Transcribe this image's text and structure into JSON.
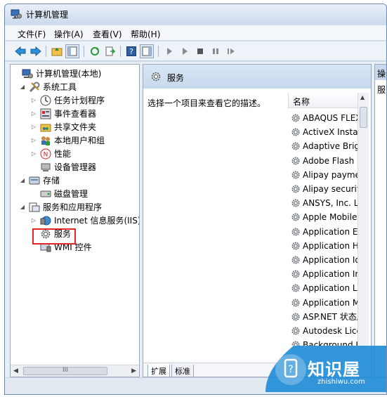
{
  "window": {
    "title": "计算机管理"
  },
  "menu": [
    "文件(F)",
    "操作(A)",
    "查看(V)",
    "帮助(H)"
  ],
  "tree": {
    "items": [
      {
        "label": "计算机管理(本地)",
        "expanded": true,
        "level": 0,
        "icon": "computer-mgmt-icon"
      },
      {
        "label": "系统工具",
        "expanded": true,
        "level": 1,
        "icon": "tools-icon"
      },
      {
        "label": "任务计划程序",
        "expanded": false,
        "level": 2,
        "icon": "clock-icon"
      },
      {
        "label": "事件查看器",
        "expanded": false,
        "level": 2,
        "icon": "event-viewer-icon"
      },
      {
        "label": "共享文件夹",
        "expanded": false,
        "level": 2,
        "icon": "shared-folder-icon"
      },
      {
        "label": "本地用户和组",
        "expanded": false,
        "level": 2,
        "icon": "users-icon"
      },
      {
        "label": "性能",
        "expanded": false,
        "level": 2,
        "icon": "performance-icon"
      },
      {
        "label": "设备管理器",
        "level": 2,
        "icon": "device-manager-icon"
      },
      {
        "label": "存储",
        "expanded": true,
        "level": 1,
        "icon": "storage-icon"
      },
      {
        "label": "磁盘管理",
        "level": 2,
        "icon": "disk-icon"
      },
      {
        "label": "服务和应用程序",
        "expanded": true,
        "level": 1,
        "icon": "services-apps-icon"
      },
      {
        "label": "Internet 信息服务(IIS)管",
        "expanded": false,
        "level": 2,
        "icon": "iis-icon"
      },
      {
        "label": "服务",
        "level": 2,
        "icon": "gear-icon",
        "highlighted": true
      },
      {
        "label": "WMI 控件",
        "level": 2,
        "icon": "wmi-icon"
      }
    ],
    "hscroll_thumb": "III"
  },
  "middle": {
    "header": "服务",
    "description": "选择一个项目来查看它的描述。",
    "column_header": "名称",
    "services": [
      "ABAQUS FLEXlm",
      "ActiveX Installer",
      "Adaptive Brightness",
      "Adobe Flash Player",
      "Alipay payment",
      "Alipay security",
      "ANSYS, Inc. License",
      "Apple Mobile Device",
      "Application Experience",
      "Application Host",
      "Application Identity",
      "Application Information",
      "Application Layer",
      "Application Management",
      "ASP.NET 状态服务",
      "Autodesk Licensing",
      "Background Intelligent"
    ],
    "tabs": [
      "扩展",
      "标准"
    ]
  },
  "actions": {
    "header": "操作",
    "sub": "服务"
  },
  "watermark": {
    "text": "知识屋",
    "url": "zhishiwu.com"
  },
  "colors": {
    "highlight_box": "#e2242b",
    "watermark_blue": "#1e8bd6"
  }
}
